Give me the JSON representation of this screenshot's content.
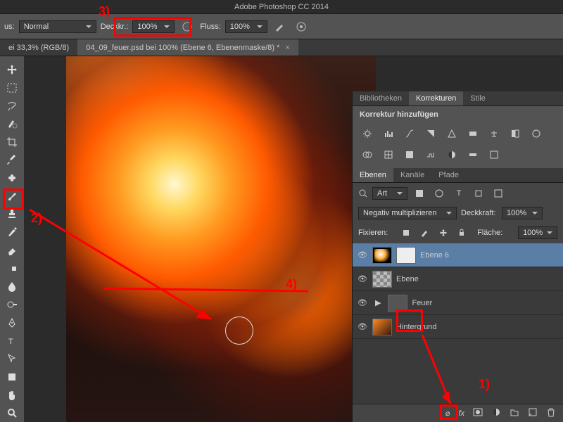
{
  "app": {
    "title": "Adobe Photoshop CC 2014"
  },
  "options": {
    "mode_label": "us:",
    "mode_value": "Normal",
    "opacity_label": "Deckkr.:",
    "opacity_value": "100%",
    "flow_label": "Fluss:",
    "flow_value": "100%"
  },
  "documents": {
    "tab1": "ei 33,3% (RGB/8)",
    "tab2": "04_09_feuer.psd bei 100% (Ebene 6, Ebenenmaske/8) *"
  },
  "panels": {
    "bib": "Bibliotheken",
    "korr": "Korrekturen",
    "stile": "Stile",
    "korr_add": "Korrektur hinzufügen"
  },
  "layers_panel": {
    "ebenen": "Ebenen",
    "kanale": "Kanäle",
    "pfade": "Pfade",
    "filter": "Art",
    "blend": "Negativ multiplizieren",
    "deck_label": "Deckkraft:",
    "deck_value": "100%",
    "fix_label": "Fixieren:",
    "fill_label": "Fläche:",
    "fill_value": "100%",
    "layers": {
      "l0": "Ebene 6",
      "l1": "Ebene",
      "l2": "Feuer",
      "l3": "Hintergrund"
    }
  },
  "annotations": {
    "n1": "1)",
    "n2": "2)",
    "n3": "3)",
    "n4": "4)"
  }
}
